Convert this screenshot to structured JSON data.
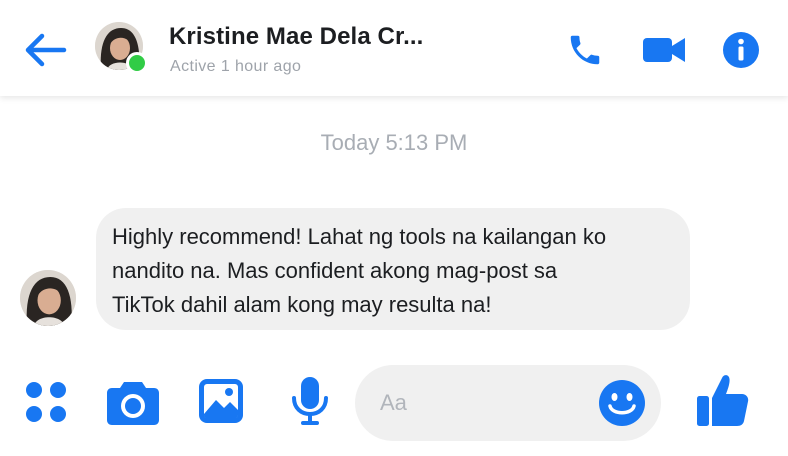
{
  "header": {
    "contact_name": "Kristine Mae Dela Cr...",
    "status": "Active 1 hour ago",
    "icons": {
      "back": "arrow-left-icon",
      "call": "phone-icon",
      "video": "video-camera-icon",
      "info": "info-icon"
    }
  },
  "conversation": {
    "timestamp": "Today 5:13 PM",
    "messages": [
      {
        "sender": "contact",
        "lines": [
          "Highly recommend! Lahat ng tools na kailangan ko",
          "nandito na. Mas confident akong mag-post sa",
          "TikTok dahil alam kong may resulta na!"
        ]
      }
    ]
  },
  "composer": {
    "placeholder": "Aa",
    "value": "",
    "icons": [
      "menu-dots-icon",
      "camera-icon",
      "gallery-icon",
      "microphone-icon",
      "emoji-icon",
      "thumbs-up-icon"
    ]
  },
  "colors": {
    "accent": "#1877f2",
    "online": "#31cc46",
    "bubble": "#f0f0f0",
    "muted_text": "#9ea3aa"
  }
}
